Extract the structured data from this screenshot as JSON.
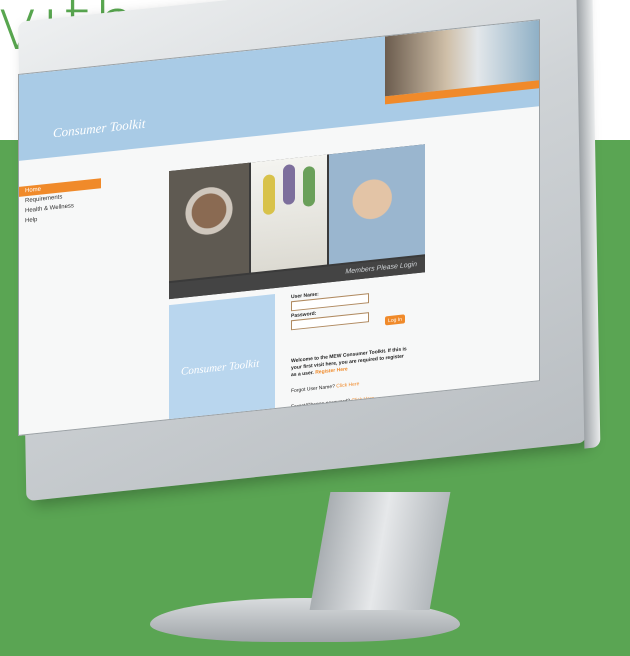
{
  "page": {
    "headline": "vith"
  },
  "site": {
    "title": "Consumer Toolkit",
    "nav_items": [
      "Home",
      "Requirements",
      "Health & Wellness",
      "Help"
    ],
    "photo_caption": "Members Please Login",
    "box_title": "Consumer Toolkit",
    "login": {
      "username_label": "User Name:",
      "password_label": "Password:",
      "login_button": "Log In",
      "welcome_text": "Welcome to the MEW Consumer Toolkit. If this is your first visit here, you are required to register as a user.",
      "register_link": "Register Here",
      "forgot_username_text": "Forgot User Name?",
      "forgot_username_link": "Click Here",
      "forgot_password_text": "Forgot/Change password?",
      "forgot_password_link": "Click Here"
    }
  },
  "colors": {
    "green": "#5aa553",
    "header_blue": "#a9cbe6",
    "accent_orange": "#f08a2a"
  }
}
